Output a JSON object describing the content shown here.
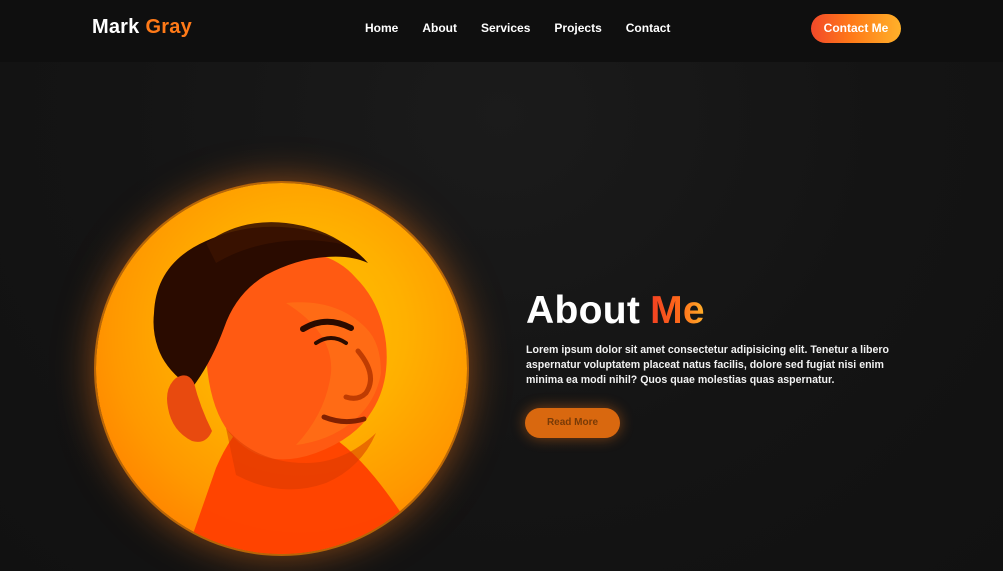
{
  "header": {
    "brand": {
      "first": "Mark",
      "last": "Gray"
    },
    "nav": [
      {
        "label": "Home"
      },
      {
        "label": "About"
      },
      {
        "label": "Services"
      },
      {
        "label": "Projects"
      },
      {
        "label": "Contact"
      }
    ],
    "cta_label": "Contact Me"
  },
  "about": {
    "title_word_1": "About",
    "title_word_2": "Me",
    "body": "Lorem ipsum dolor sit amet consectetur adipisicing elit. Tenetur a libero aspernatur voluptatem placeat natus facilis, dolore sed fugiat nisi enim minima ea modi nihil? Quos quae molestias quas aspernatur.",
    "button_label": "Read More"
  },
  "colors": {
    "background": "#141414",
    "accent_orange": "#ff7a18",
    "accent_red": "#f23f22",
    "accent_gold": "#ffb12a"
  },
  "icons": {
    "portrait": "portrait-photo"
  }
}
